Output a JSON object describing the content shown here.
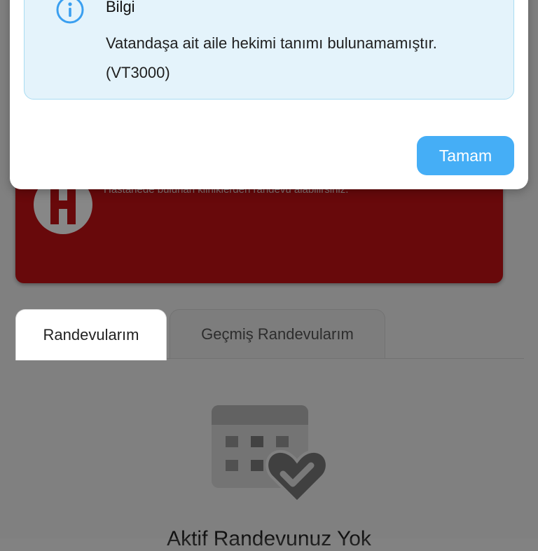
{
  "hospital_card": {
    "description": "Hastanede bulunan kliniklerden randevu alabilirsiniz."
  },
  "tabs": [
    {
      "label": "Randevularım",
      "active": true
    },
    {
      "label": "Geçmiş Randevularım",
      "active": false
    }
  ],
  "empty_state": {
    "text": "Aktif Randevunuz Yok",
    "icon": "calendar-heart-check-icon"
  },
  "dialog": {
    "title": "Bilgi",
    "message": "Vatandaşa ait aile hekimi tanımı bulunamamıştır. (VT3000)",
    "ok_label": "Tamam",
    "icon": "info-icon"
  },
  "colors": {
    "accent": "#45aef6",
    "hospital_card": "#c51115",
    "info_box_bg": "#e4f3fb",
    "info_box_border": "#a9dcf2"
  }
}
